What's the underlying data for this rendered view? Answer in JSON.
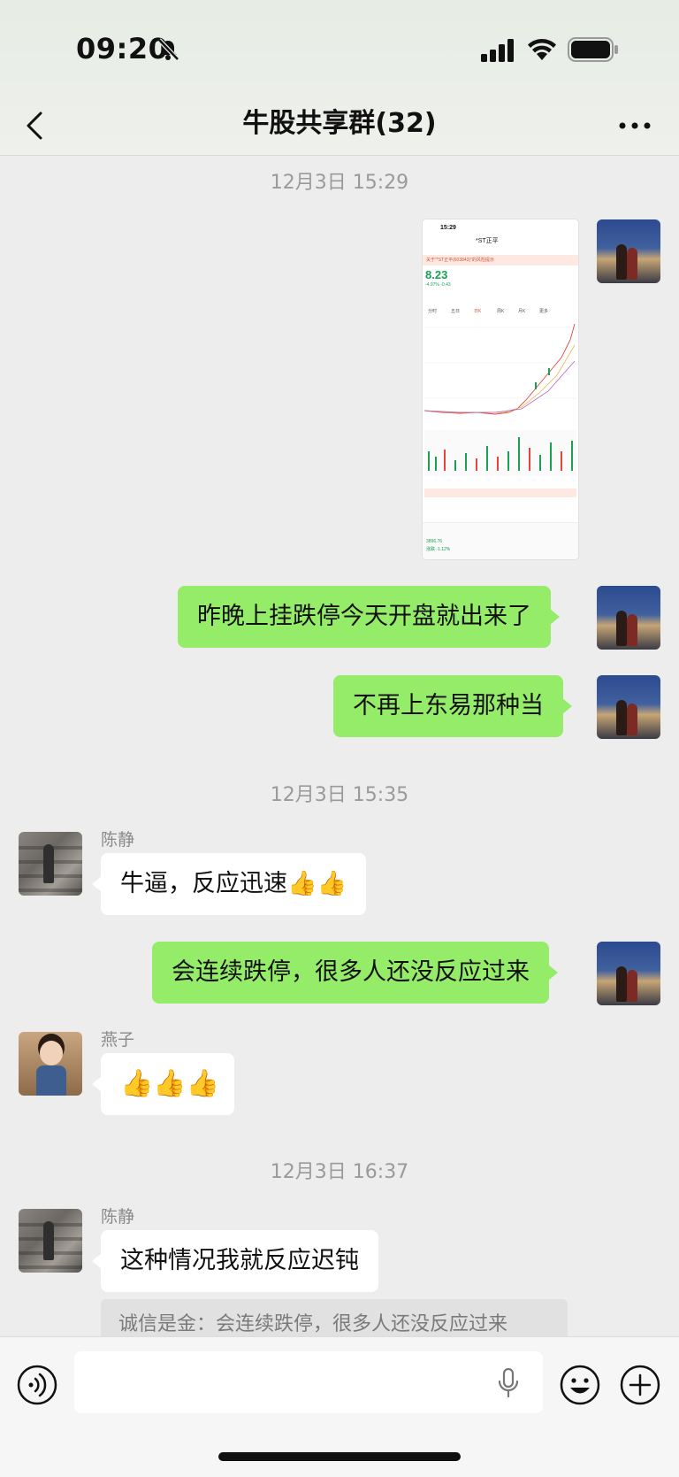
{
  "status_bar": {
    "time": "09:20",
    "icons": [
      "bell-slash-icon",
      "signal-icon",
      "wifi-icon",
      "battery-icon"
    ]
  },
  "nav": {
    "title": "牛股共享群(32)",
    "back_icon": "chevron-left-icon",
    "more_icon": "more-dots-icon"
  },
  "messages": {
    "ts1": "12月3日 15:29",
    "stock_image": {
      "time": "15:29",
      "name": "*ST正平",
      "warning": "关于\"*ST正平(603843)\"的风险提示",
      "price": "8.23",
      "change": "-4.97%  -0.43",
      "tabs": [
        "分时",
        "五日",
        "日K",
        "周K",
        "月K",
        "更多"
      ],
      "index_value": "3896.76",
      "index_change": "涨跌 -1.12%"
    },
    "m1": "昨晚上挂跌停今天开盘就出来了",
    "m2": "不再上东易那种当",
    "ts2": "12月3日 15:35",
    "m3_sender": "陈静",
    "m3": "牛逼，反应迅速👍👍",
    "m4": "会连续跌停，很多人还没反应过来",
    "m5_sender": "燕子",
    "m5": "👍👍👍",
    "ts3": "12月3日 16:37",
    "m6_sender": "陈静",
    "m6": "这种情况我就反应迟钝",
    "m6_quote": "诚信是金：会连续跌停，很多人还没反应过来"
  },
  "input_bar": {
    "value": "",
    "placeholder": "",
    "icons": [
      "voice-icon",
      "microphone-icon",
      "emoji-icon",
      "plus-icon"
    ]
  },
  "colors": {
    "self_bubble": "#95ec69",
    "other_bubble": "#ffffff",
    "background": "#ededed"
  }
}
